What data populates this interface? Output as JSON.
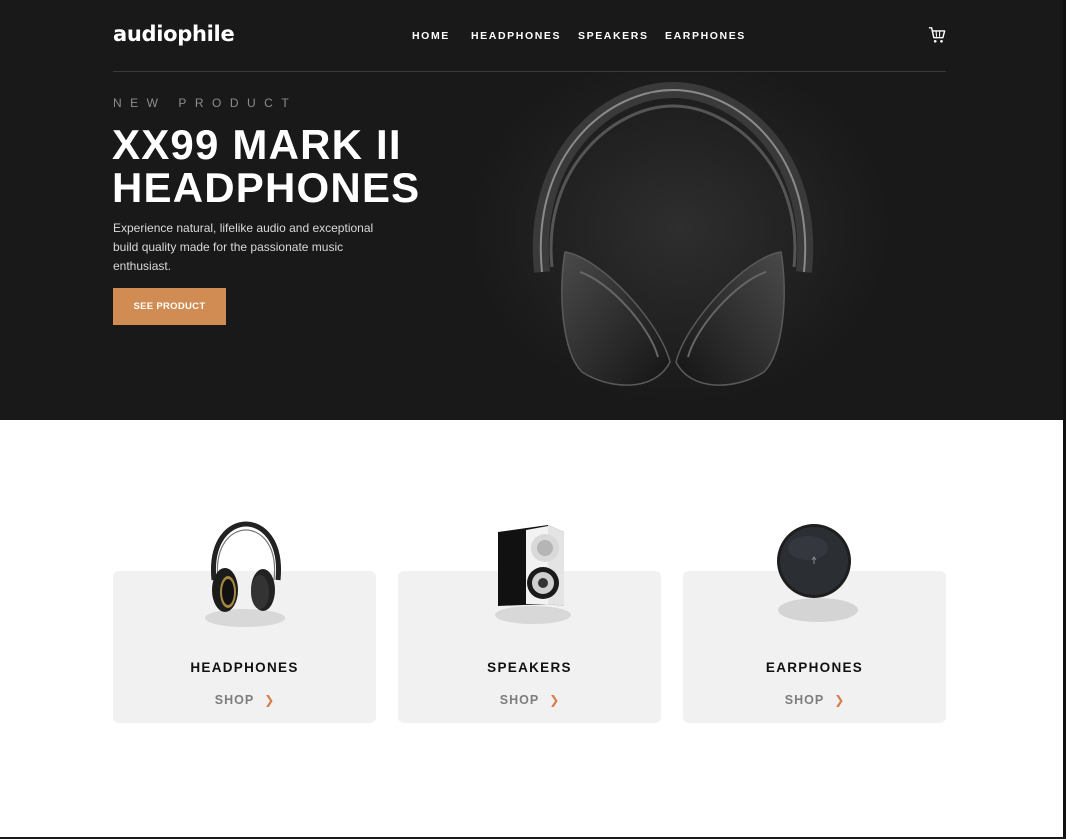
{
  "brand": {
    "logo": "audiophile"
  },
  "nav": {
    "items": [
      "HOME",
      "HEADPHONES",
      "SPEAKERS",
      "EARPHONES"
    ],
    "cart_icon": "cart-icon"
  },
  "hero": {
    "overline": "NEW PRODUCT",
    "title_line1": "XX99 MARK II",
    "title_line2": "HEADPHONES",
    "description": "Experience natural, lifelike audio and exceptional build quality made for the passionate music enthusiast.",
    "cta_label": "SEE PRODUCT",
    "image": "headphones-hero-image"
  },
  "categories": [
    {
      "title": "HEADPHONES",
      "shop_label": "SHOP",
      "icon": "headphones-thumbnail"
    },
    {
      "title": "SPEAKERS",
      "shop_label": "SHOP",
      "icon": "speaker-thumbnail"
    },
    {
      "title": "EARPHONES",
      "shop_label": "SHOP",
      "icon": "earphones-case-thumbnail"
    }
  ],
  "colors": {
    "hero_bg": "#191919",
    "accent": "#D87D4A",
    "card_bg": "#F1F1F1"
  }
}
